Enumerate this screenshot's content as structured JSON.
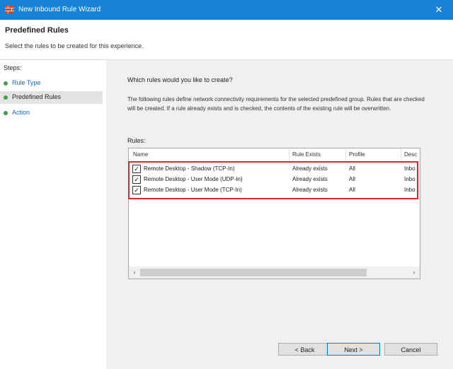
{
  "window": {
    "title": "New Inbound Rule Wizard",
    "close_glyph": "✕"
  },
  "header": {
    "title": "Predefined Rules",
    "subtitle": "Select the rules to be created for this experience."
  },
  "steps": {
    "label": "Steps:",
    "items": [
      {
        "label": "Rule Type"
      },
      {
        "label": "Predefined Rules"
      },
      {
        "label": "Action"
      }
    ]
  },
  "main": {
    "question": "Which rules would you like to create?",
    "description": "The following rules define network connectivity requirements for the selected predefined group. Rules that are checked will be created. If a rule already exists and is checked, the contents of the existing rule will be overwritten.",
    "rules_label": "Rules:",
    "columns": [
      "Name",
      "Rule Exists",
      "Profile",
      "Desc"
    ],
    "rows": [
      {
        "name": "Remote Desktop - Shadow (TCP-In)",
        "exists": "Already exists",
        "profile": "All",
        "desc": "Inbo"
      },
      {
        "name": "Remote Desktop - User Mode (UDP-In)",
        "exists": "Already exists",
        "profile": "All",
        "desc": "Inbo"
      },
      {
        "name": "Remote Desktop - User Mode (TCP-In)",
        "exists": "Already exists",
        "profile": "All",
        "desc": "Inbo"
      }
    ],
    "check_glyph": "✓"
  },
  "scrollbar": {
    "left": "‹",
    "right": "›"
  },
  "buttons": {
    "back": "< Back",
    "next": "Next >",
    "cancel": "Cancel"
  },
  "colors": {
    "titlebar": "#1683d8",
    "highlight": "#e0262b",
    "step_dot": "#3fa33f",
    "link": "#1d63b5"
  }
}
